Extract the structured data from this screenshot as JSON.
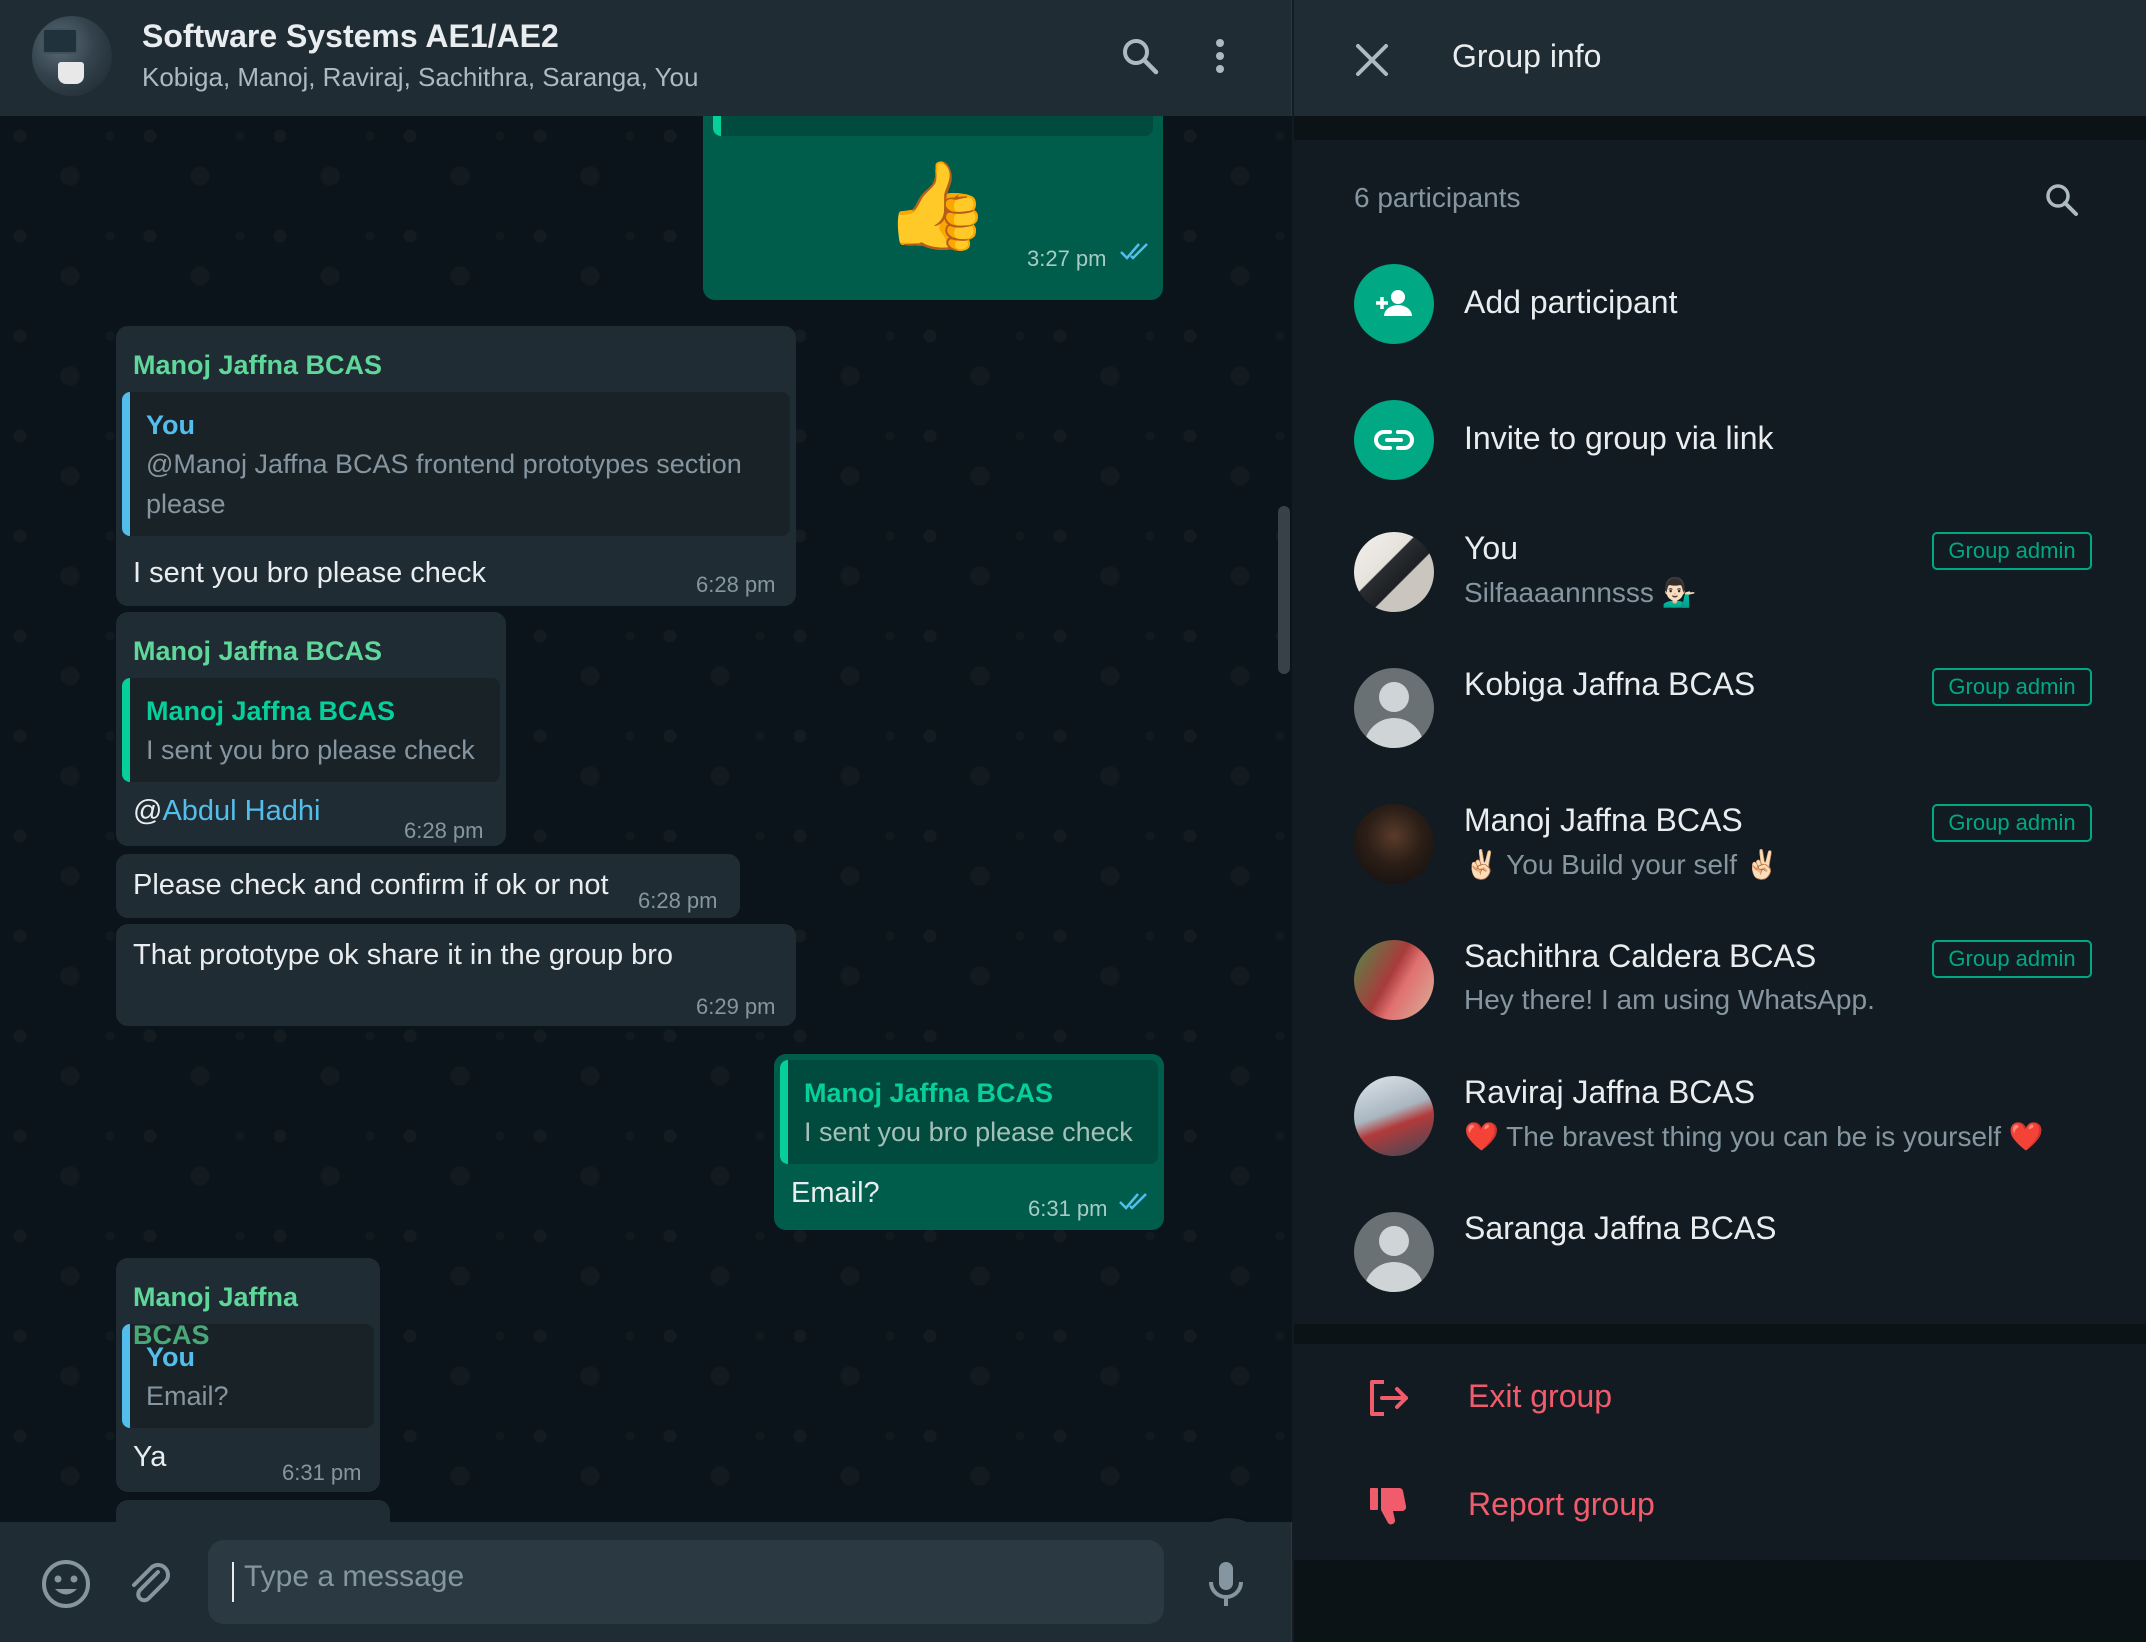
{
  "chat": {
    "title": "Software Systems AE1/AE2",
    "members": "Kobiga, Manoj, Raviraj, Sachithra, Saranga, You",
    "messages": {
      "m1": {
        "emoji": "👍",
        "time": "3:27 pm"
      },
      "m2": {
        "sender": "Manoj Jaffna BCAS",
        "quote_name": "You",
        "quote_line1": "@Manoj Jaffna BCAS frontend prototypes section",
        "quote_line2": "please",
        "text": "I sent you bro please check",
        "time": "6:28 pm"
      },
      "m3": {
        "sender": "Manoj Jaffna BCAS",
        "quote_name": "Manoj Jaffna BCAS",
        "quote_text": "I sent you bro please check",
        "text_prefix": "@",
        "mention": "Abdul Hadhi",
        "time": "6:28 pm"
      },
      "m4": {
        "text": "Please check and confirm if ok or not",
        "time": "6:28 pm"
      },
      "m5": {
        "text": "That prototype ok share it in the group bro",
        "time": "6:29 pm"
      },
      "m6": {
        "quote_name": "Manoj Jaffna BCAS",
        "quote_text": "I sent you bro please check",
        "text": "Email?",
        "time": "6:31 pm"
      },
      "m7": {
        "sender": "Manoj Jaffna BCAS",
        "quote_name": "You",
        "quote_text": "Email?",
        "text": "Ya",
        "time": "6:31 pm"
      }
    },
    "composer": {
      "placeholder": "Type a message"
    }
  },
  "info": {
    "title": "Group info",
    "participants_count": "6 participants",
    "add_participant": "Add participant",
    "invite_link": "Invite to group via link",
    "participants": [
      {
        "name": "You",
        "status": "Silfaaaannnsss 💁🏻‍♂️",
        "badge": "Group admin"
      },
      {
        "name": "Kobiga Jaffna BCAS",
        "status": "",
        "badge": "Group admin"
      },
      {
        "name": "Manoj Jaffna BCAS",
        "status": "✌🏻 You Build your self ✌🏻",
        "badge": "Group admin"
      },
      {
        "name": "Sachithra Caldera BCAS",
        "status": "Hey there! I am using WhatsApp.",
        "badge": "Group admin"
      },
      {
        "name": "Raviraj Jaffna BCAS",
        "status": "❤️ The bravest thing you can be is yourself ❤️",
        "badge": ""
      },
      {
        "name": "Saranga Jaffna BCAS",
        "status": "",
        "badge": ""
      }
    ],
    "exit_group": "Exit group",
    "report_group": "Report group"
  },
  "colors": {
    "accent": "#00a884",
    "danger": "#f15c6d",
    "incoming_bubble": "#202c33",
    "outgoing_bubble": "#005c4b"
  }
}
